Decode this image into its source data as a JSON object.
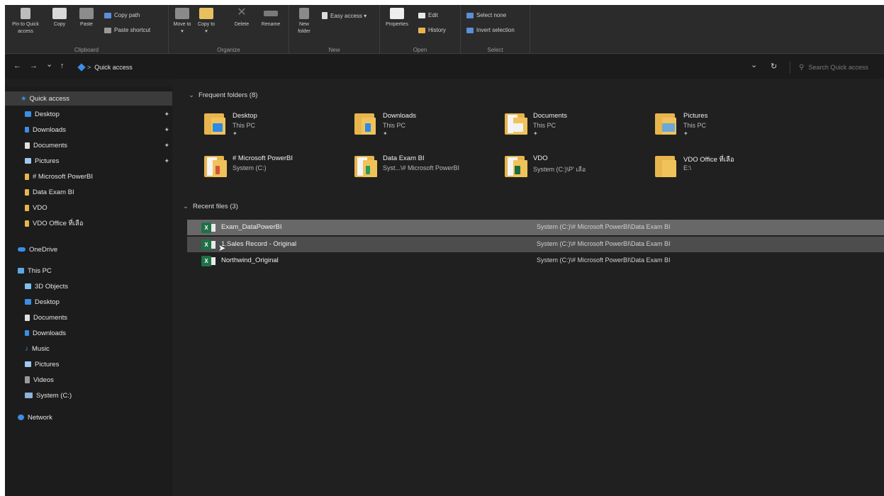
{
  "ribbon": {
    "clipboard": {
      "pin_label": "Pin to Quick access",
      "copy_label": "Copy",
      "paste_label": "Paste",
      "copy_path": "Copy path",
      "paste_shortcut": "Paste shortcut",
      "group_label": "Clipboard"
    },
    "organize": {
      "move_to": "Move to ▾",
      "copy_to": "Copy to ▾",
      "delete": "Delete",
      "rename": "Rename",
      "group_label": "Organize"
    },
    "new": {
      "new_folder": "New folder",
      "easy_access": "Easy access ▾",
      "group_label": "New"
    },
    "open": {
      "properties": "Properties",
      "edit": "Edit",
      "history": "History",
      "group_label": "Open"
    },
    "select": {
      "select_none": "Select none",
      "invert_selection": "Invert selection",
      "group_label": "Select"
    }
  },
  "address": {
    "back": "←",
    "forward": "→",
    "recent": "⌄",
    "up": "↑",
    "path_sep": ">",
    "path_current": "Quick access",
    "dropdown": "⌄",
    "refresh": "↻",
    "search_placeholder": "Search Quick access"
  },
  "sidebar": {
    "quick_access": "Quick access",
    "quick_items": [
      {
        "label": "Desktop",
        "pinned": true
      },
      {
        "label": "Downloads",
        "pinned": true
      },
      {
        "label": "Documents",
        "pinned": true
      },
      {
        "label": "Pictures",
        "pinned": true
      },
      {
        "label": "# Microsoft PowerBI",
        "pinned": false
      },
      {
        "label": "Data Exam BI",
        "pinned": false
      },
      {
        "label": "VDO",
        "pinned": false
      },
      {
        "label": "VDO Office ที่เลือ",
        "pinned": false
      }
    ],
    "onedrive": "OneDrive",
    "this_pc": "This PC",
    "pc_items": [
      "3D Objects",
      "Desktop",
      "Documents",
      "Downloads",
      "Music",
      "Pictures",
      "Videos",
      "System (C:)"
    ],
    "network": "Network",
    "pin_glyph": "✦"
  },
  "content": {
    "frequent_title": "Frequent folders (8)",
    "folders": [
      {
        "name": "Desktop",
        "sub": "This PC",
        "pinned": true
      },
      {
        "name": "Downloads",
        "sub": "This PC",
        "pinned": true
      },
      {
        "name": "Documents",
        "sub": "This PC",
        "pinned": true
      },
      {
        "name": "Pictures",
        "sub": "This PC",
        "pinned": true
      },
      {
        "name": "# Microsoft PowerBI",
        "sub": "System (C:)",
        "pinned": false
      },
      {
        "name": "Data Exam BI",
        "sub": "Syst...\\# Microsoft PowerBI",
        "pinned": false
      },
      {
        "name": "VDO",
        "sub": "System (C:)\\P' เลือ",
        "pinned": false
      },
      {
        "name": "VDO Office ที่เลือ",
        "sub": "E:\\",
        "pinned": false
      }
    ],
    "recent_title": "Recent files (3)",
    "recent": [
      {
        "name": "Exam_DataPowerBI",
        "path": "System (C:)\\# Microsoft PowerBI\\Data Exam BI"
      },
      {
        "name": "1.Sales Record - Original",
        "path": "System (C:)\\# Microsoft PowerBI\\Data Exam BI"
      },
      {
        "name": "Northwind_Original",
        "path": "System (C:)\\# Microsoft PowerBI\\Data Exam BI"
      }
    ],
    "excel_glyph": "X"
  },
  "colors": {
    "background": "#1f1f1f",
    "folder_yellow": "#e8b44d",
    "accent_blue": "#3a8ee6",
    "excel_green": "#1e7145"
  }
}
